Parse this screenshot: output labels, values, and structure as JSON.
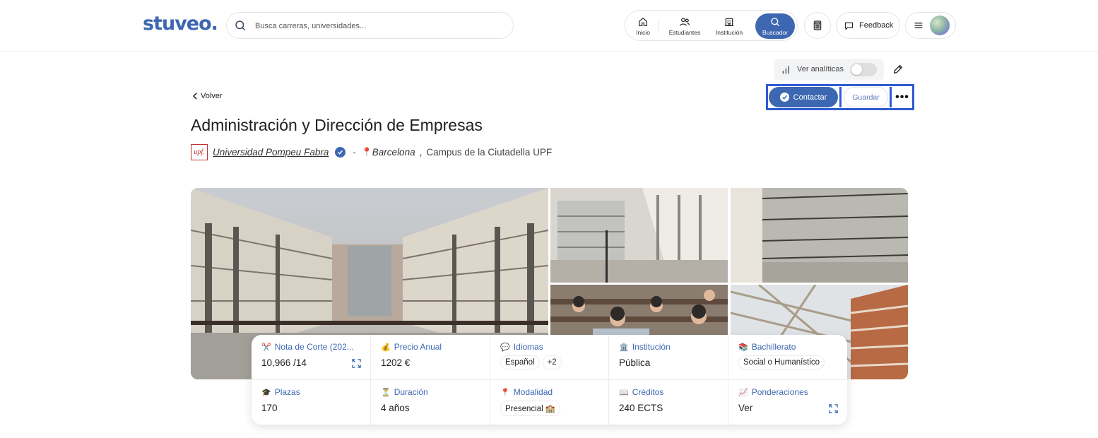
{
  "brand": {
    "logo_text": "stuveo.",
    "accent": "#3d67b1"
  },
  "search": {
    "placeholder": "Busca carreras, universidades..."
  },
  "nav": {
    "items": [
      {
        "label": "Inicio",
        "icon": "home-icon"
      },
      {
        "label": "Estudiantes",
        "icon": "users-icon"
      },
      {
        "label": "Institución",
        "icon": "building-icon"
      },
      {
        "label": "Buscador",
        "icon": "search-icon",
        "active": true
      }
    ]
  },
  "header_actions": {
    "feedback_label": "Feedback"
  },
  "analytics": {
    "label": "Ver analíticas",
    "enabled": false
  },
  "back_label": "Volver",
  "actions": {
    "contact_label": "Contactar",
    "save_label": "Guardar",
    "more_label": "•••"
  },
  "program": {
    "title": "Administración y Dirección de Empresas",
    "university_logo_text": "upf.",
    "university": "Universidad Pompeu Fabra",
    "separator": "-",
    "city": "Barcelona",
    "city_comma": ",",
    "campus": "Campus de la Ciutadella UPF"
  },
  "info": {
    "nota": {
      "label": "Nota de Corte (202...",
      "value": "10,966",
      "suffix": "/14"
    },
    "precio": {
      "label": "Precio Anual",
      "value": "1202 €"
    },
    "idiomas": {
      "label": "Idiomas",
      "chips": [
        "Español",
        "+2"
      ]
    },
    "institucion": {
      "label": "Institución",
      "value": "Pública"
    },
    "bachillerato": {
      "label": "Bachillerato",
      "chips": [
        "Social o Humanístico"
      ]
    },
    "plazas": {
      "label": "Plazas",
      "value": "170"
    },
    "duracion": {
      "label": "Duración",
      "value": "4 años"
    },
    "modalidad": {
      "label": "Modalidad",
      "chips": [
        "Presencial 🏫"
      ]
    },
    "creditos": {
      "label": "Créditos",
      "value": "240 ECTS"
    },
    "ponderaciones": {
      "label": "Ponderaciones",
      "value": "Ver"
    }
  }
}
